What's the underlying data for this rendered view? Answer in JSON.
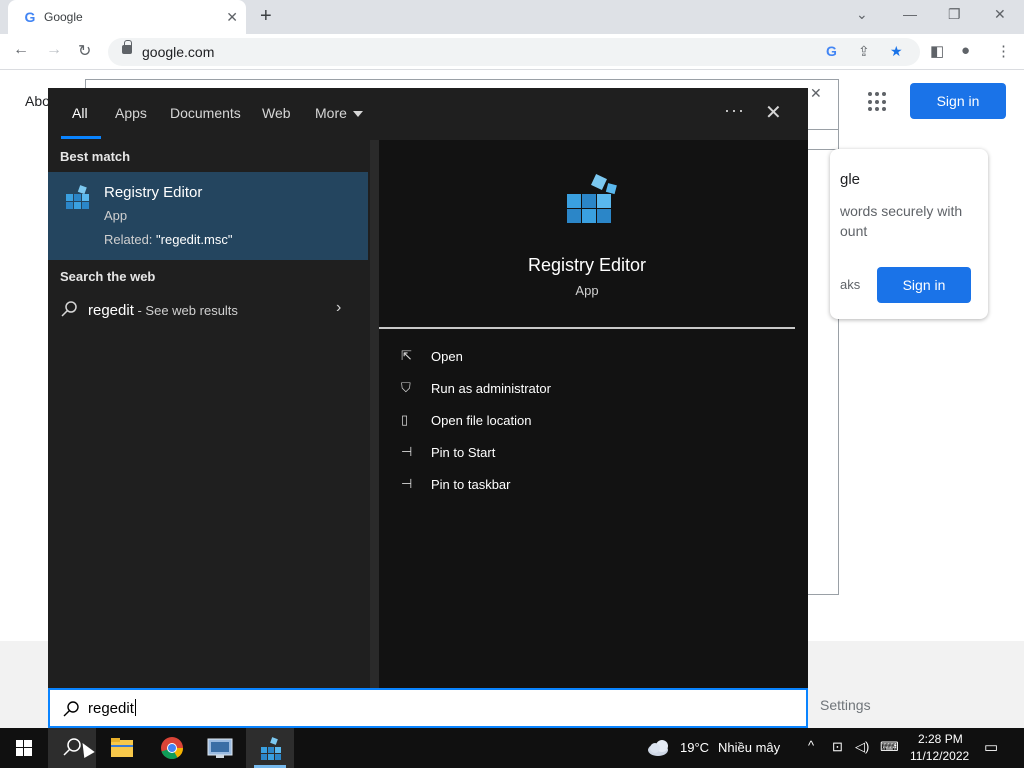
{
  "browser": {
    "tab_title": "Google",
    "tab_favicon": "G",
    "url": "google.com",
    "new_tab": "+"
  },
  "google_page": {
    "about": "Abo",
    "sign_in": "Sign in",
    "card_title": "gle",
    "card_text": "words securely with\nount",
    "card_link": "aks",
    "card_sign_in": "Sign in",
    "footer_settings": "Settings"
  },
  "search": {
    "tabs": [
      "All",
      "Apps",
      "Documents",
      "Web",
      "More"
    ],
    "active_tab": "All",
    "best_match_heading": "Best match",
    "best_match": {
      "title": "Registry Editor",
      "type": "App",
      "related_prefix": "Related: ",
      "related_value": "\"regedit.msc\"",
      "icon": "registry-editor-icon"
    },
    "web_heading": "Search the web",
    "web_result": {
      "query": "regedit",
      "suffix": " - See web results"
    },
    "detail": {
      "title": "Registry Editor",
      "type": "App",
      "actions": [
        {
          "label": "Open",
          "icon": "open-icon"
        },
        {
          "label": "Run as administrator",
          "icon": "shield-icon"
        },
        {
          "label": "Open file location",
          "icon": "file-location-icon"
        },
        {
          "label": "Pin to Start",
          "icon": "pin-icon"
        },
        {
          "label": "Pin to taskbar",
          "icon": "pin-icon"
        }
      ]
    },
    "query": "regedit"
  },
  "taskbar": {
    "weather_temp": "19°C",
    "weather_desc": "Nhiều mây",
    "time": "2:28 PM",
    "date": "11/12/2022"
  },
  "colors": {
    "accent": "#0a84ff",
    "best_match_bg": "#24455f",
    "chrome_blue": "#1a73e8"
  }
}
